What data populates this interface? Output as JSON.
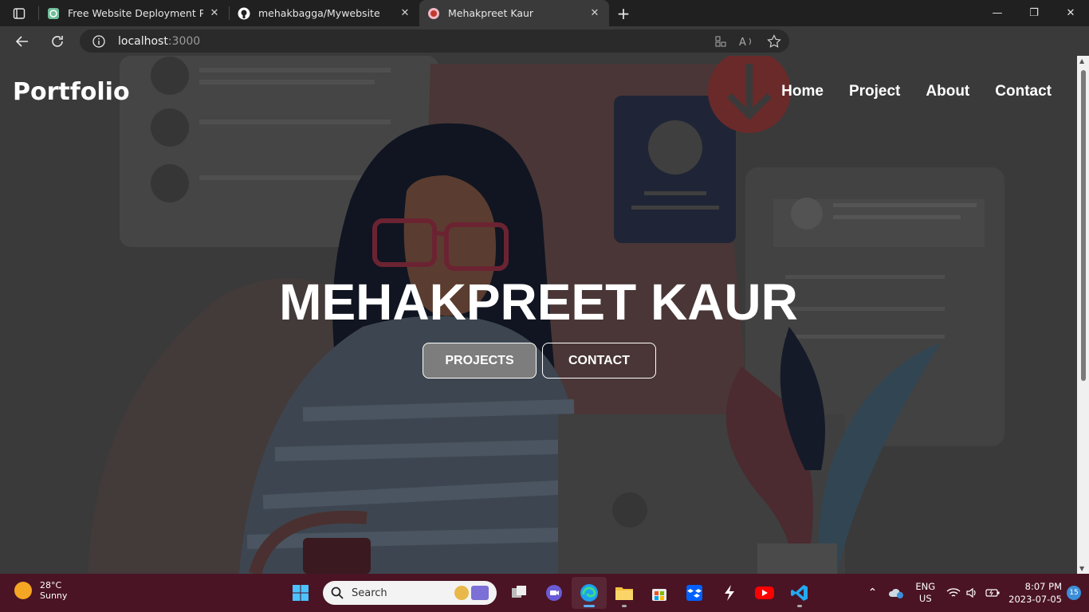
{
  "browser": {
    "tabs": [
      {
        "title": "Free Website Deployment Platfor",
        "icon": "render-icon",
        "active": false
      },
      {
        "title": "mehakbagga/Mywebsite",
        "icon": "github-icon",
        "active": false
      },
      {
        "title": "Mehakpreet Kaur",
        "icon": "site-favicon",
        "active": true
      }
    ],
    "url_host": "localhost",
    "url_port": ":3000"
  },
  "site": {
    "logo": "Portfolio",
    "nav": [
      "Home",
      "Project",
      "About",
      "Contact"
    ],
    "hero_name": "MEHAKPREET KAUR",
    "buttons": {
      "projects": "PROJECTS",
      "contact": "CONTACT"
    }
  },
  "taskbar": {
    "weather_temp": "28°C",
    "weather_desc": "Sunny",
    "search_placeholder": "Search",
    "lang_top": "ENG",
    "lang_bottom": "US",
    "time": "8:07 PM",
    "date": "2023-07-05",
    "notification_count": "15"
  },
  "colors": {
    "taskbar": "#4a1424",
    "overlay": "#3b3b3b",
    "primary_button": "#7d7d7d"
  }
}
